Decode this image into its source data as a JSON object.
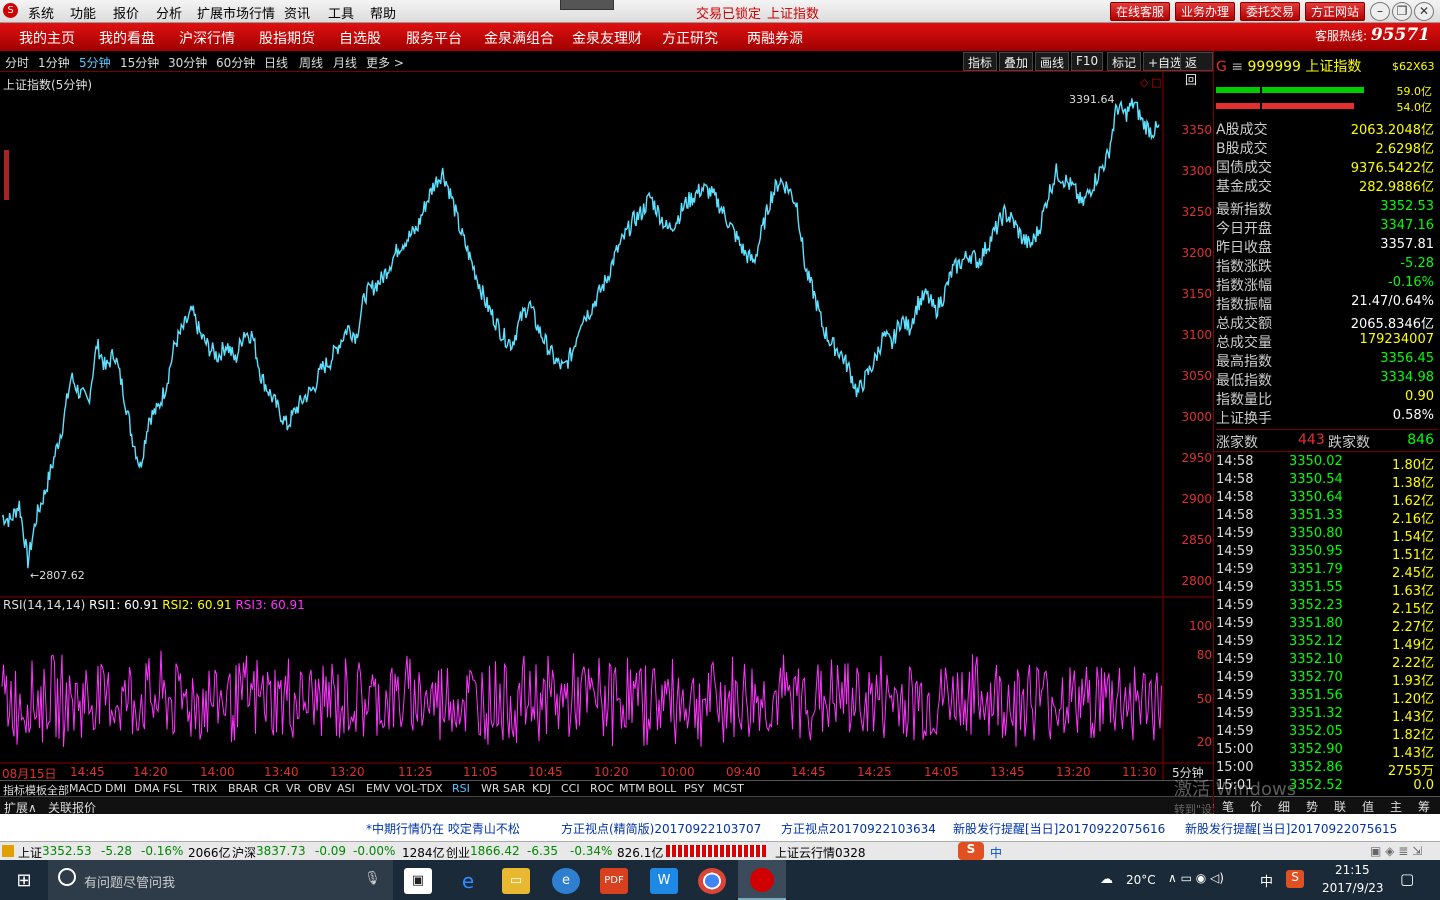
{
  "menu": {
    "logo": "S",
    "items": [
      "系统",
      "功能",
      "报价",
      "分析",
      "扩展市场行情",
      "资讯",
      "工具",
      "帮助"
    ],
    "status1": "交易已锁定",
    "status2": "上证指数",
    "buttons": [
      "在线客服",
      "业务办理",
      "委托交易",
      "方正网站"
    ]
  },
  "nav": {
    "items": [
      "我的主页",
      "我的看盘",
      "沪深行情",
      "股指期货",
      "自选股",
      "服务平台",
      "金泉满组合",
      "金泉友理财",
      "方正研究",
      "两融券源"
    ],
    "hotline_label": "客服热线:",
    "hotline_num": "95571"
  },
  "toolbar": {
    "periods": [
      "分时",
      "1分钟",
      "5分钟",
      "15分钟",
      "30分钟",
      "60分钟",
      "日线",
      "周线",
      "月线",
      "更多 >"
    ],
    "active": "5分钟",
    "tools": [
      "指标",
      "叠加",
      "画线",
      "F10",
      "标记",
      "+自选",
      "返回"
    ]
  },
  "chart_data": [
    {
      "type": "line",
      "title": "上证指数(5分钟)",
      "ylim": [
        2790,
        3400
      ],
      "yticks": [
        3350,
        3300,
        3250,
        3200,
        3150,
        3100,
        3050,
        3000,
        2950,
        2900,
        2850,
        2800
      ],
      "xticks": [
        "08月15日",
        "14:45",
        "14:20",
        "14:00",
        "13:40",
        "13:20",
        "11:25",
        "11:05",
        "10:45",
        "10:20",
        "10:00",
        "09:40",
        "14:45",
        "14:25",
        "14:05",
        "13:45",
        "13:20",
        "11:30"
      ],
      "period": "5分钟",
      "max_label": "3391.64",
      "min_label": "2807.62",
      "points": [
        2880,
        2875,
        2895,
        2825,
        2880,
        2910,
        2950,
        2990,
        3050,
        3030,
        3020,
        3090,
        3060,
        3080,
        3035,
        2980,
        2940,
        3000,
        3010,
        3040,
        3090,
        3110,
        3130,
        3100,
        3085,
        3075,
        3090,
        3070,
        3105,
        3100,
        3050,
        3030,
        3010,
        2990,
        3010,
        3025,
        3035,
        3060,
        3070,
        3090,
        3110,
        3100,
        3150,
        3160,
        3170,
        3190,
        3210,
        3220,
        3230,
        3260,
        3285,
        3300,
        3270,
        3230,
        3200,
        3170,
        3140,
        3120,
        3100,
        3090,
        3120,
        3140,
        3110,
        3090,
        3070,
        3060,
        3080,
        3120,
        3130,
        3150,
        3170,
        3200,
        3220,
        3240,
        3250,
        3270,
        3250,
        3230,
        3240,
        3260,
        3270,
        3280,
        3275,
        3260,
        3240,
        3220,
        3200,
        3190,
        3230,
        3270,
        3290,
        3280,
        3260,
        3180,
        3150,
        3110,
        3090,
        3080,
        3060,
        3030,
        3050,
        3070,
        3100,
        3090,
        3120,
        3110,
        3140,
        3150,
        3130,
        3150,
        3180,
        3190,
        3200,
        3190,
        3210,
        3230,
        3250,
        3240,
        3220,
        3210,
        3230,
        3270,
        3300,
        3290,
        3280,
        3260,
        3280,
        3300,
        3320,
        3380,
        3370,
        3385,
        3360,
        3350,
        3352.53
      ]
    },
    {
      "type": "line",
      "title": "RSI(14,14,14)",
      "ylim": [
        10,
        110
      ],
      "yticks": [
        100.0,
        80.0,
        50.0,
        20.0
      ],
      "series": [
        {
          "name": "RSI1",
          "value": 60.91
        },
        {
          "name": "RSI2",
          "value": 60.91
        },
        {
          "name": "RSI3",
          "value": 60.91
        }
      ]
    }
  ],
  "rsi": {
    "label": "RSI(14,14,14)",
    "r1": "RSI1: 60.91",
    "r2": "RSI2: 60.91",
    "r3": "RSI3: 60.91"
  },
  "indicators": [
    "指标",
    "模板",
    "全部",
    "MACD",
    "DMI",
    "DMA",
    "FSL",
    "TRIX",
    "BRAR",
    "CR",
    "VR",
    "OBV",
    "ASI",
    "EMV",
    "VOL-TDX",
    "RSI",
    "WR",
    "SAR",
    "KDJ",
    "CCI",
    "ROC",
    "MTM",
    "BOLL",
    "PSY",
    "MCST"
  ],
  "ext": [
    "扩展∧",
    "关联报价"
  ],
  "panel": {
    "code": "999999",
    "name": "上证指数",
    "badge": "$62X63",
    "bar1": "59.0亿",
    "bar2": "54.0亿",
    "vol": [
      [
        "A股成交",
        "2063.2048亿"
      ],
      [
        "B股成交",
        "2.6298亿"
      ],
      [
        "国债成交",
        "9376.5422亿"
      ],
      [
        "基金成交",
        "282.9886亿"
      ]
    ],
    "stats": [
      [
        "最新指数",
        "3352.53",
        "#00ff00"
      ],
      [
        "今日开盘",
        "3347.16",
        "#00ff00"
      ],
      [
        "昨日收盘",
        "3357.81",
        "#ffffff"
      ],
      [
        "指数涨跌",
        "-5.28",
        "#00ff00"
      ],
      [
        "指数涨幅",
        "-0.16%",
        "#00ff00"
      ],
      [
        "指数振幅",
        "21.47/0.64%",
        "#ffffff"
      ],
      [
        "总成交额",
        "2065.8346亿",
        "#ffffff"
      ],
      [
        "总成交量",
        "179234007",
        "#ffff00"
      ],
      [
        "最高指数",
        "3356.45",
        "#00ff00"
      ],
      [
        "最低指数",
        "3334.98",
        "#00ff00"
      ],
      [
        "指数量比",
        "0.90",
        "#ffff00"
      ],
      [
        "上证换手",
        "0.58%",
        "#ffffff"
      ]
    ],
    "updown": {
      "up_label": "涨家数",
      "up": "443",
      "down_label": "跌家数",
      "down": "846"
    },
    "ticks": [
      [
        "14:58",
        "3350.02",
        "1.80亿"
      ],
      [
        "14:58",
        "3350.54",
        "1.38亿"
      ],
      [
        "14:58",
        "3350.64",
        "1.62亿"
      ],
      [
        "14:58",
        "3351.33",
        "2.16亿"
      ],
      [
        "14:59",
        "3350.80",
        "1.54亿"
      ],
      [
        "14:59",
        "3350.95",
        "1.51亿"
      ],
      [
        "14:59",
        "3351.79",
        "2.45亿"
      ],
      [
        "14:59",
        "3351.55",
        "1.63亿"
      ],
      [
        "14:59",
        "3352.23",
        "2.15亿"
      ],
      [
        "14:59",
        "3351.80",
        "2.27亿"
      ],
      [
        "14:59",
        "3352.12",
        "1.49亿"
      ],
      [
        "14:59",
        "3352.10",
        "2.22亿"
      ],
      [
        "14:59",
        "3352.70",
        "1.93亿"
      ],
      [
        "14:59",
        "3351.56",
        "1.20亿"
      ],
      [
        "14:59",
        "3351.32",
        "1.43亿"
      ],
      [
        "14:59",
        "3352.05",
        "1.82亿"
      ],
      [
        "15:00",
        "3352.90",
        "1.43亿"
      ],
      [
        "15:00",
        "3352.86",
        "2755万"
      ],
      [
        "15:01",
        "3352.52",
        "0.0"
      ]
    ],
    "tabs": [
      "笔",
      "价",
      "细",
      "势",
      "联",
      "值",
      "主",
      "筹"
    ],
    "watermark1": "激活 Windows",
    "watermark2": "转到\"设置\"以激活 Windows。"
  },
  "news": [
    "*中期行情仍在 咬定青山不松",
    "方正视点(精简版)20170922103707",
    "方正视点20170922103634",
    "新股发行提醒[当日]20170922075616",
    "新股发行提醒[当日]20170922075615"
  ],
  "status": {
    "sh_label": "上证",
    "sh": "3352.53",
    "sh_chg": "-5.28",
    "sh_pct": "-0.16%",
    "sh_amt": "2066亿",
    "hs_label": "沪深",
    "hs": "3837.73",
    "hs_chg": "-0.09",
    "hs_pct": "-0.00%",
    "hs_amt": "1284亿",
    "cy_label": "创业",
    "cy": "1866.42",
    "cy_chg": "-6.35",
    "cy_pct": "-0.34%",
    "cy_amt": "826.1亿",
    "cloud": "上证云行情0328",
    "ime": "中"
  },
  "taskbar": {
    "search": "有问题尽管问我",
    "weather": "20°C",
    "ime": "中",
    "time": "21:15",
    "date": "2017/9/23"
  }
}
